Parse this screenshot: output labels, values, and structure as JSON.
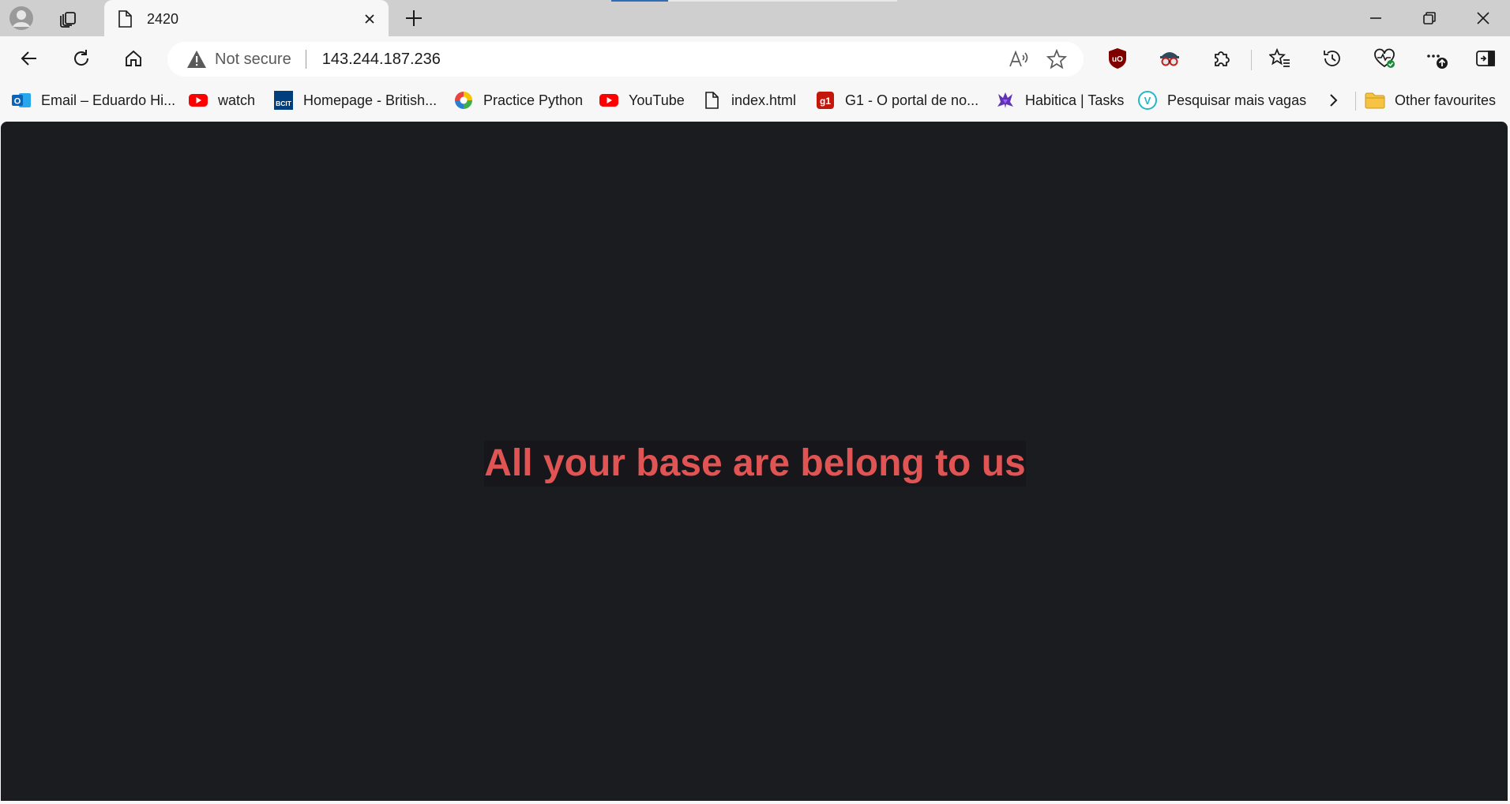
{
  "browser": {
    "tab": {
      "title": "2420"
    },
    "address_bar": {
      "security_label": "Not secure",
      "url": "143.244.187.236"
    },
    "bookmarks": [
      {
        "label": "Email – Eduardo Hi...",
        "icon": "outlook-icon"
      },
      {
        "label": "watch",
        "icon": "youtube-icon"
      },
      {
        "label": "Homepage - British...",
        "icon": "bcit-icon"
      },
      {
        "label": "Practice Python",
        "icon": "practice-python-icon"
      },
      {
        "label": "YouTube",
        "icon": "youtube-icon"
      },
      {
        "label": "index.html",
        "icon": "file-icon"
      },
      {
        "label": "G1 - O portal de no...",
        "icon": "g1-icon"
      },
      {
        "label": "Habitica | Tasks",
        "icon": "habitica-icon"
      },
      {
        "label": "Pesquisar mais vagas",
        "icon": "vagas-icon"
      }
    ],
    "other_favourites": "Other favourites",
    "bcit_badge": "BCIT",
    "g1_badge": "g1",
    "vagas_badge": "V",
    "outlook_badge": "O"
  },
  "page": {
    "headline": "All your base are belong to us",
    "background_color": "#1b1c1f",
    "headline_color": "#e05454"
  }
}
